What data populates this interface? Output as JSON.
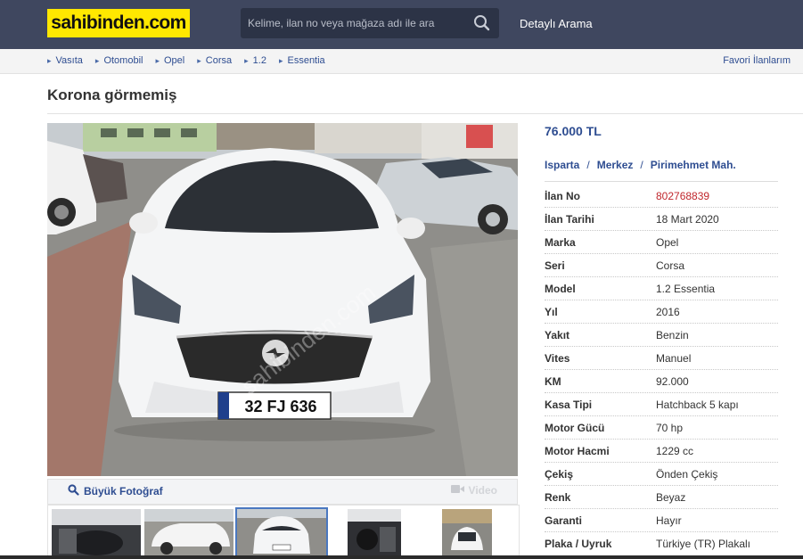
{
  "header": {
    "logo": "sahibinden.com",
    "search_placeholder": "Kelime, ilan no veya mağaza adı ile ara",
    "detail_search": "Detaylı Arama"
  },
  "breadcrumb": [
    "Vasıta",
    "Otomobil",
    "Opel",
    "Corsa",
    "1.2",
    "Essentia"
  ],
  "favorites_link": "Favori İlanlarım",
  "listing": {
    "title": "Korona görmemiş",
    "price": "76.000 TL",
    "location": [
      "Isparta",
      "Merkez",
      "Pirimehmet Mah."
    ],
    "location_separator": "/",
    "plate_text": "32 FJ 636",
    "watermark": "sahibinden.com"
  },
  "gallery": {
    "big_photo": "Büyük Fotoğraf",
    "video": "Video"
  },
  "details": [
    {
      "key": "İlan No",
      "value": "802768839",
      "highlight": true
    },
    {
      "key": "İlan Tarihi",
      "value": "18 Mart 2020"
    },
    {
      "key": "Marka",
      "value": "Opel"
    },
    {
      "key": "Seri",
      "value": "Corsa"
    },
    {
      "key": "Model",
      "value": "1.2 Essentia"
    },
    {
      "key": "Yıl",
      "value": "2016"
    },
    {
      "key": "Yakıt",
      "value": "Benzin"
    },
    {
      "key": "Vites",
      "value": "Manuel"
    },
    {
      "key": "KM",
      "value": "92.000"
    },
    {
      "key": "Kasa Tipi",
      "value": "Hatchback 5 kapı"
    },
    {
      "key": "Motor Gücü",
      "value": "70 hp"
    },
    {
      "key": "Motor Hacmi",
      "value": "1229 cc"
    },
    {
      "key": "Çekiş",
      "value": "Önden Çekiş"
    },
    {
      "key": "Renk",
      "value": "Beyaz"
    },
    {
      "key": "Garanti",
      "value": "Hayır"
    },
    {
      "key": "Plaka / Uyruk",
      "value": "Türkiye (TR) Plakalı"
    }
  ],
  "colors": {
    "header_bg": "#3f475f",
    "logo_bg": "#ffe800",
    "link_blue": "#2e4d91",
    "listing_no_red": "#c0272d"
  },
  "icons": {
    "search": "magnifier-icon",
    "big_photo": "magnifier-icon",
    "video": "video-camera-icon",
    "breadcrumb": "triangle-right-icon"
  }
}
